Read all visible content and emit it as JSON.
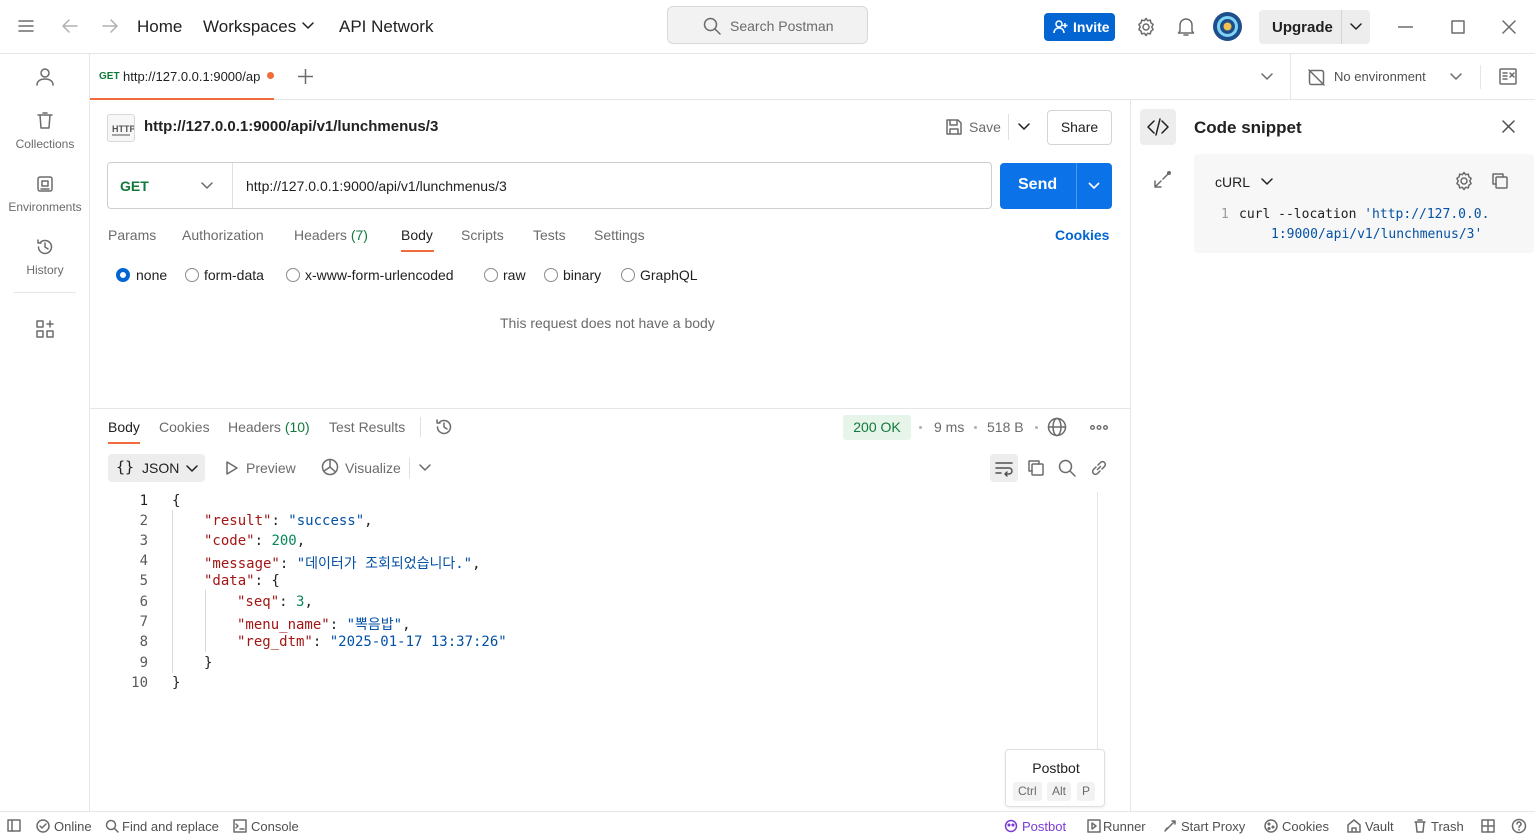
{
  "topbar": {
    "nav_home": "Home",
    "nav_workspaces": "Workspaces",
    "nav_api_network": "API Network",
    "search_placeholder": "Search Postman",
    "invite_label": "Invite",
    "upgrade_label": "Upgrade",
    "accent_color": "#0265d2"
  },
  "sidebar": {
    "items": [
      {
        "label": "Collections"
      },
      {
        "label": "Environments"
      },
      {
        "label": "History"
      }
    ]
  },
  "tabs": {
    "active_tab_method": "GET",
    "active_tab_label": "http://127.0.0.1:9000/ap",
    "environment_label": "No environment"
  },
  "request": {
    "title": "http://127.0.0.1:9000/api/v1/lunchmenus/3",
    "save_label": "Save",
    "share_label": "Share",
    "method": "GET",
    "url": "http://127.0.0.1:9000/api/v1/lunchmenus/3",
    "send_label": "Send",
    "tabs": [
      {
        "label": "Params"
      },
      {
        "label": "Authorization"
      },
      {
        "label": "Headers",
        "count": "(7)"
      },
      {
        "label": "Body"
      },
      {
        "label": "Scripts"
      },
      {
        "label": "Tests"
      },
      {
        "label": "Settings"
      }
    ],
    "cookies_label": "Cookies",
    "body_types": [
      "none",
      "form-data",
      "x-www-form-urlencoded",
      "raw",
      "binary",
      "GraphQL"
    ],
    "selected_body_type": "none",
    "empty_body_message": "This request does not have a body"
  },
  "response": {
    "tabs": [
      {
        "label": "Body"
      },
      {
        "label": "Cookies"
      },
      {
        "label": "Headers",
        "count": "(10)"
      },
      {
        "label": "Test Results"
      }
    ],
    "status": "200 OK",
    "time": "9 ms",
    "size": "518 B",
    "format_label": "JSON",
    "preview_label": "Preview",
    "visualize_label": "Visualize",
    "line_numbers": [
      "1",
      "2",
      "3",
      "4",
      "5",
      "6",
      "7",
      "8",
      "9",
      "10"
    ],
    "body": {
      "result_key": "\"result\"",
      "result_value": "\"success\"",
      "code_key": "\"code\"",
      "code_value": "200",
      "message_key": "\"message\"",
      "message_value": "\"데이터가 조회되었습니다.\"",
      "data_key": "\"data\"",
      "seq_key": "\"seq\"",
      "seq_value": "3",
      "menu_name_key": "\"menu_name\"",
      "menu_name_value": "\"뽁음밥\"",
      "reg_dtm_key": "\"reg_dtm\"",
      "reg_dtm_value": "\"2025-01-17 13:37:26\""
    }
  },
  "postbot": {
    "title": "Postbot",
    "keys": [
      "Ctrl",
      "Alt",
      "P"
    ]
  },
  "code_snippet": {
    "title": "Code snippet",
    "language": "cURL",
    "line_number": "1",
    "command": "curl --location",
    "url_part1": "'http://127.0.0.",
    "url_part2": "1:9000/api/v1/lunchmenus/3'"
  },
  "statusbar": {
    "online": "Online",
    "find_replace": "Find and replace",
    "console": "Console",
    "postbot": "Postbot",
    "runner": "Runner",
    "start_proxy": "Start Proxy",
    "cookies": "Cookies",
    "vault": "Vault",
    "trash": "Trash"
  }
}
